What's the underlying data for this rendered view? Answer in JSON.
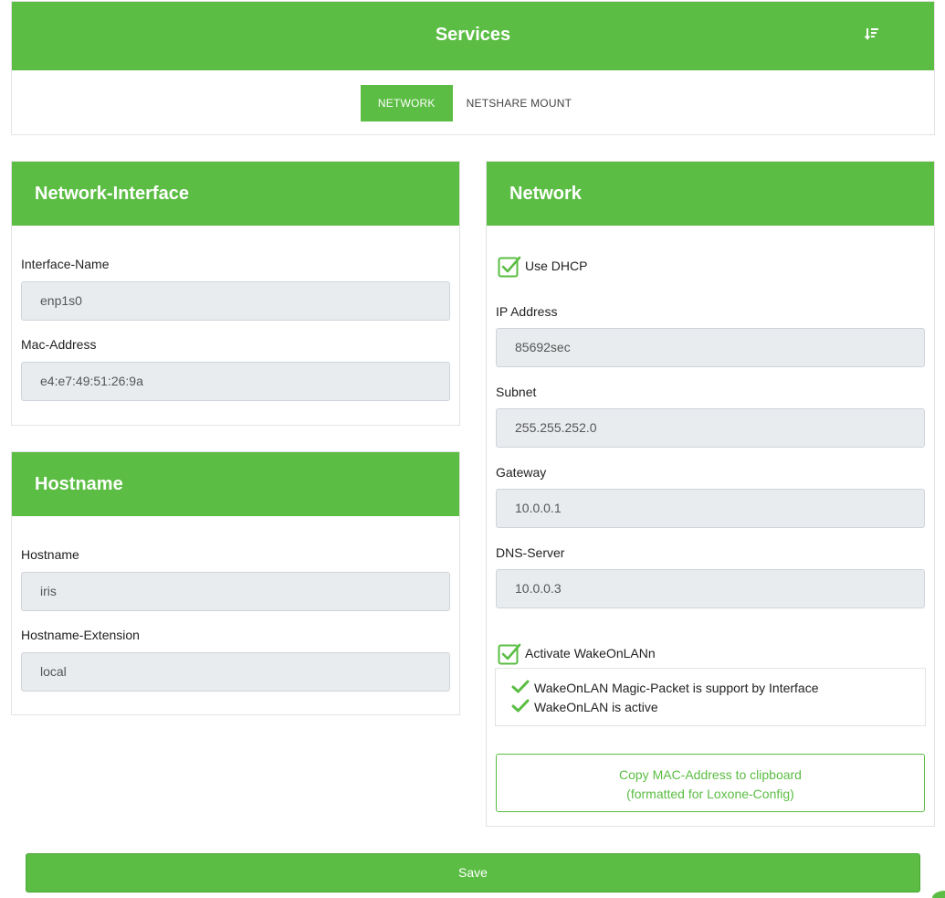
{
  "header": {
    "title": "Services",
    "tabs": [
      {
        "label": "NETWORK",
        "active": true
      },
      {
        "label": "NETSHARE MOUNT",
        "active": false
      }
    ]
  },
  "network_interface": {
    "title": "Network-Interface",
    "interface_name_label": "Interface-Name",
    "interface_name_value": "enp1s0",
    "mac_label": "Mac-Address",
    "mac_value": "e4:e7:49:51:26:9a"
  },
  "hostname_card": {
    "title": "Hostname",
    "hostname_label": "Hostname",
    "hostname_value": "iris",
    "extension_label": "Hostname-Extension",
    "extension_value": "local"
  },
  "network": {
    "title": "Network",
    "dhcp_label": "Use DHCP",
    "dhcp_checked": true,
    "ip_label": "IP Address",
    "ip_value": "85692sec",
    "subnet_label": "Subnet",
    "subnet_value": "255.255.252.0",
    "gateway_label": "Gateway",
    "gateway_value": "10.0.0.1",
    "dns_label": "DNS-Server",
    "dns_value": "10.0.0.3",
    "wol_label": "Activate WakeOnLANn",
    "wol_checked": true,
    "wol_status": [
      "WakeOnLAN Magic-Packet is support by Interface",
      "WakeOnLAN is active"
    ],
    "copy_line1": "Copy MAC-Address to clipboard",
    "copy_line2": "(formatted for Loxone-Config)"
  },
  "save_label": "Save",
  "colors": {
    "accent": "#5bbd43",
    "input_bg": "#e9ecef",
    "border": "#e3e3e3"
  },
  "icons": {
    "sort": "sort-descending-icon",
    "checkbox": "checkbox-checked-icon",
    "status": "checkmark-icon"
  }
}
